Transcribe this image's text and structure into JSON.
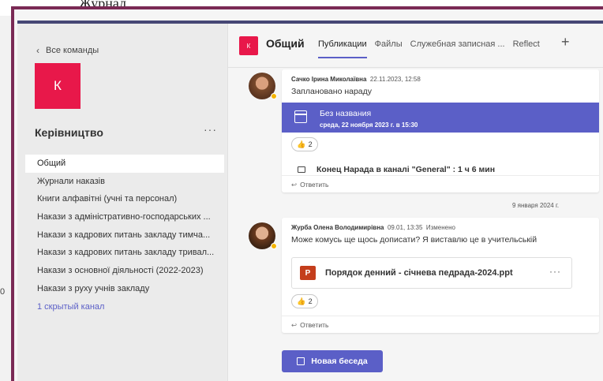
{
  "background": {
    "top_text": "Журнал",
    "left_number": "0"
  },
  "team_pane": {
    "back_label": "Все команды",
    "avatar_letter": "К",
    "team_name": "Керівництво",
    "more_glyph": "···",
    "channels": [
      {
        "label": "Общий",
        "active": true
      },
      {
        "label": "Журнали наказів"
      },
      {
        "label": "Книги алфавітні (учні та персонал)"
      },
      {
        "label": "Накази з адміністративно-господарських ..."
      },
      {
        "label": "Накази з кадрових питань закладу тимча..."
      },
      {
        "label": "Накази з кадрових питань закладу тривал..."
      },
      {
        "label": "Накази з основної діяльності (2022-2023)"
      },
      {
        "label": "Накази з руху учнів закладу"
      },
      {
        "label": "1 скрытый канал",
        "link": true
      }
    ]
  },
  "header": {
    "avatar_letter": "К",
    "title": "Общий",
    "tabs": [
      {
        "label": "Публикации",
        "active": true
      },
      {
        "label": "Файлы"
      },
      {
        "label": "Служебная записная ..."
      },
      {
        "label": "Reflect"
      }
    ],
    "add_glyph": "+"
  },
  "posts": [
    {
      "author": "Сачко Ірина Миколаївна",
      "time": "22.11.2023, 12:58",
      "message": "Заплановано нараду",
      "event": {
        "title": "Без названия",
        "when": "среда, 22 ноября 2023 г. в 15:30"
      },
      "reaction": {
        "emoji": "👍",
        "count": "2"
      },
      "meeting": "Конец Нарада в каналі \"General\" : 1 ч 6 мин",
      "reply_label": "Ответить"
    },
    {
      "author": "Журба Олена Володимирівна",
      "time": "09.01, 13:35",
      "edited": "Изменено",
      "message": "Може комусь ще щось дописати? Я виставлю це в учительській",
      "file": {
        "name": "Порядок денний - січнева педрада-2024.ppt",
        "badge": "P",
        "more": "···"
      },
      "reaction": {
        "emoji": "👍",
        "count": "2"
      },
      "reply_label": "Ответить"
    }
  ],
  "date_separator": "9 января 2024 г.",
  "new_conversation_label": "Новая беседа",
  "colors": {
    "accent": "#5b5fc7",
    "team_red": "#e8184a",
    "frame": "#7a2a55",
    "ppt": "#c43e1c"
  }
}
